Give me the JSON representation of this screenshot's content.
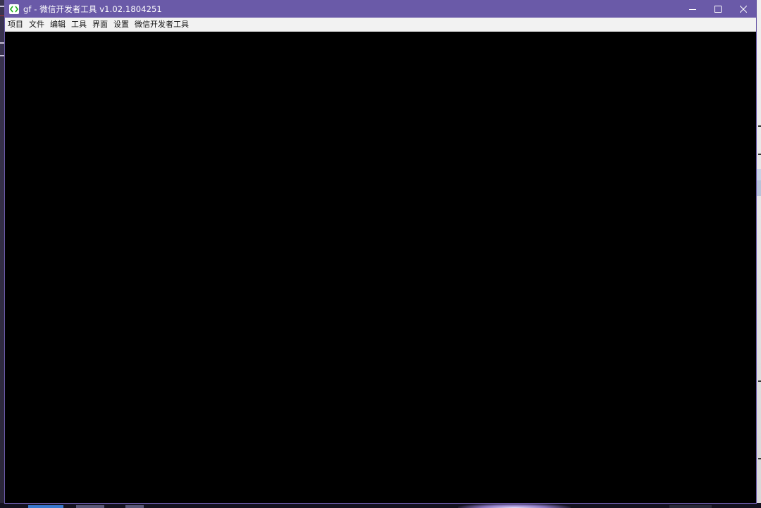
{
  "window": {
    "title": "gf - 微信开发者工具 v1.02.1804251",
    "icon": "wechat-devtools-logo-icon",
    "controls": [
      "minimize-icon",
      "maximize-icon",
      "close-icon"
    ]
  },
  "menubar": {
    "items": [
      {
        "label": "项目"
      },
      {
        "label": "文件"
      },
      {
        "label": "编辑"
      },
      {
        "label": "工具"
      },
      {
        "label": "界面"
      },
      {
        "label": "设置"
      },
      {
        "label": "微信开发者工具"
      }
    ]
  },
  "colors": {
    "titlebar": "#6a5aa8",
    "menubar": "#f2f2f2",
    "content": "#000000",
    "logo_green": "#1aad19"
  }
}
